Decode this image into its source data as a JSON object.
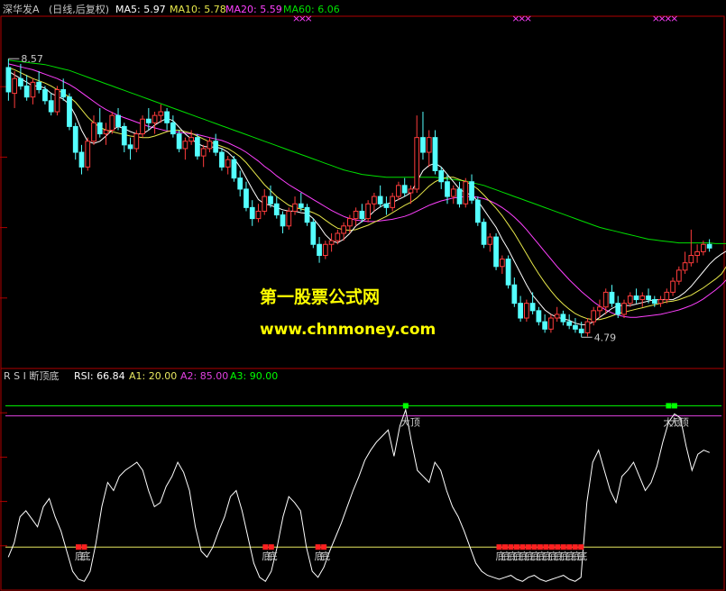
{
  "colors": {
    "up": "#ff3c3c",
    "down": "#54ffff",
    "ma5": "#ffffff",
    "ma10": "#e8e84a",
    "ma20": "#ff40ff",
    "ma60": "#00e000",
    "frame": "#b00000",
    "text": "#c8c8c8",
    "rsi": "#ffffff",
    "line_top": "#00ff00",
    "line_mid": "#e040e0",
    "line_bot": "#e8e860",
    "sig_top": "#00ff00",
    "sig_bot": "#ff2020",
    "watermark": "#ffff00"
  },
  "price_header": {
    "name": "深华发A",
    "period": "(日线,后复权)",
    "ma5": "MA5: 5.97",
    "ma10": "MA10: 5.78",
    "ma20": "MA20: 5.59",
    "ma60": "MA60: 6.06"
  },
  "rsi_header": {
    "title": "R S I 断顶底",
    "rsi": "RSI: 66.84",
    "a1": "A1: 20.00",
    "a2": "A2: 85.00",
    "a3": "A3: 90.00"
  },
  "watermark": {
    "line1": "第一股票公式网",
    "line2": "www.chnmoney.com"
  },
  "chart_data": [
    {
      "type": "candlestick",
      "ylim": [
        4.5,
        9.0
      ],
      "annotations": {
        "high_label": "8.57",
        "low_label": "4.79"
      },
      "ohlc": [
        [
          8.45,
          8.57,
          8.0,
          8.12
        ],
        [
          8.1,
          8.4,
          7.9,
          8.3
        ],
        [
          8.3,
          8.5,
          8.15,
          8.2
        ],
        [
          8.2,
          8.35,
          8.0,
          8.05
        ],
        [
          8.05,
          8.3,
          7.95,
          8.25
        ],
        [
          8.25,
          8.4,
          8.1,
          8.15
        ],
        [
          8.15,
          8.2,
          7.95,
          8.0
        ],
        [
          8.0,
          8.1,
          7.8,
          7.85
        ],
        [
          7.85,
          8.2,
          7.8,
          8.15
        ],
        [
          8.15,
          8.3,
          8.0,
          8.05
        ],
        [
          8.05,
          8.1,
          7.6,
          7.65
        ],
        [
          7.65,
          7.7,
          7.2,
          7.3
        ],
        [
          7.3,
          7.4,
          7.0,
          7.1
        ],
        [
          7.1,
          7.5,
          7.05,
          7.45
        ],
        [
          7.45,
          7.8,
          7.4,
          7.7
        ],
        [
          7.7,
          7.9,
          7.5,
          7.55
        ],
        [
          7.55,
          7.7,
          7.4,
          7.6
        ],
        [
          7.6,
          7.85,
          7.55,
          7.8
        ],
        [
          7.8,
          7.9,
          7.6,
          7.65
        ],
        [
          7.65,
          7.7,
          7.3,
          7.4
        ],
        [
          7.4,
          7.5,
          7.2,
          7.35
        ],
        [
          7.35,
          7.6,
          7.3,
          7.55
        ],
        [
          7.55,
          7.8,
          7.5,
          7.75
        ],
        [
          7.75,
          7.9,
          7.6,
          7.7
        ],
        [
          7.7,
          7.85,
          7.55,
          7.8
        ],
        [
          7.8,
          7.95,
          7.7,
          7.85
        ],
        [
          7.85,
          7.9,
          7.6,
          7.7
        ],
        [
          7.7,
          7.8,
          7.5,
          7.55
        ],
        [
          7.55,
          7.6,
          7.3,
          7.35
        ],
        [
          7.35,
          7.5,
          7.2,
          7.45
        ],
        [
          7.45,
          7.6,
          7.4,
          7.5
        ],
        [
          7.5,
          7.55,
          7.2,
          7.25
        ],
        [
          7.25,
          7.4,
          7.1,
          7.35
        ],
        [
          7.35,
          7.5,
          7.3,
          7.45
        ],
        [
          7.45,
          7.55,
          7.25,
          7.3
        ],
        [
          7.3,
          7.35,
          7.05,
          7.1
        ],
        [
          7.1,
          7.25,
          7.0,
          7.2
        ],
        [
          7.2,
          7.25,
          6.9,
          6.95
        ],
        [
          6.95,
          7.05,
          6.7,
          6.8
        ],
        [
          6.8,
          6.9,
          6.5,
          6.55
        ],
        [
          6.55,
          6.65,
          6.3,
          6.4
        ],
        [
          6.4,
          6.6,
          6.35,
          6.5
        ],
        [
          6.5,
          6.8,
          6.45,
          6.7
        ],
        [
          6.7,
          6.85,
          6.55,
          6.6
        ],
        [
          6.6,
          6.7,
          6.4,
          6.45
        ],
        [
          6.45,
          6.5,
          6.2,
          6.3
        ],
        [
          6.3,
          6.55,
          6.25,
          6.5
        ],
        [
          6.5,
          6.7,
          6.45,
          6.6
        ],
        [
          6.6,
          6.75,
          6.5,
          6.55
        ],
        [
          6.55,
          6.6,
          6.3,
          6.35
        ],
        [
          6.35,
          6.4,
          6.0,
          6.05
        ],
        [
          6.05,
          6.15,
          5.8,
          5.9
        ],
        [
          5.9,
          6.1,
          5.85,
          6.05
        ],
        [
          6.05,
          6.2,
          5.95,
          6.1
        ],
        [
          6.1,
          6.25,
          6.05,
          6.2
        ],
        [
          6.2,
          6.35,
          6.1,
          6.3
        ],
        [
          6.3,
          6.45,
          6.2,
          6.4
        ],
        [
          6.4,
          6.55,
          6.3,
          6.5
        ],
        [
          6.5,
          6.6,
          6.35,
          6.4
        ],
        [
          6.4,
          6.65,
          6.35,
          6.6
        ],
        [
          6.6,
          6.75,
          6.5,
          6.7
        ],
        [
          6.7,
          6.85,
          6.55,
          6.6
        ],
        [
          6.6,
          6.7,
          6.45,
          6.55
        ],
        [
          6.55,
          6.75,
          6.5,
          6.7
        ],
        [
          6.7,
          6.9,
          6.65,
          6.85
        ],
        [
          6.85,
          6.95,
          6.7,
          6.75
        ],
        [
          6.75,
          6.85,
          6.6,
          6.8
        ],
        [
          6.8,
          7.8,
          6.75,
          7.5
        ],
        [
          7.5,
          7.85,
          7.2,
          7.3
        ],
        [
          7.3,
          7.6,
          7.1,
          7.5
        ],
        [
          7.5,
          7.6,
          7.0,
          7.05
        ],
        [
          7.05,
          7.1,
          6.8,
          6.9
        ],
        [
          6.9,
          7.0,
          6.6,
          6.7
        ],
        [
          6.7,
          6.85,
          6.6,
          6.8
        ],
        [
          6.8,
          6.9,
          6.55,
          6.6
        ],
        [
          6.6,
          6.95,
          6.55,
          6.9
        ],
        [
          6.9,
          7.0,
          6.6,
          6.65
        ],
        [
          6.65,
          6.7,
          6.3,
          6.35
        ],
        [
          6.35,
          6.4,
          6.0,
          6.05
        ],
        [
          6.05,
          6.2,
          5.95,
          6.15
        ],
        [
          6.15,
          6.2,
          5.7,
          5.75
        ],
        [
          5.75,
          5.9,
          5.65,
          5.85
        ],
        [
          5.85,
          5.9,
          5.45,
          5.5
        ],
        [
          5.5,
          5.6,
          5.2,
          5.25
        ],
        [
          5.25,
          5.35,
          5.0,
          5.05
        ],
        [
          5.05,
          5.3,
          5.0,
          5.25
        ],
        [
          5.25,
          5.4,
          5.1,
          5.15
        ],
        [
          5.15,
          5.2,
          4.95,
          5.0
        ],
        [
          5.0,
          5.1,
          4.85,
          4.9
        ],
        [
          4.9,
          5.1,
          4.85,
          5.05
        ],
        [
          5.05,
          5.2,
          5.0,
          5.1
        ],
        [
          5.1,
          5.15,
          4.95,
          5.0
        ],
        [
          5.0,
          5.1,
          4.9,
          4.95
        ],
        [
          4.95,
          5.05,
          4.85,
          4.9
        ],
        [
          4.9,
          5.0,
          4.79,
          4.85
        ],
        [
          4.85,
          5.05,
          4.8,
          5.0
        ],
        [
          5.0,
          5.2,
          4.95,
          5.15
        ],
        [
          5.15,
          5.3,
          5.05,
          5.2
        ],
        [
          5.2,
          5.45,
          5.1,
          5.4
        ],
        [
          5.4,
          5.5,
          5.2,
          5.25
        ],
        [
          5.25,
          5.35,
          5.05,
          5.1
        ],
        [
          5.1,
          5.3,
          5.05,
          5.25
        ],
        [
          5.25,
          5.4,
          5.2,
          5.35
        ],
        [
          5.35,
          5.45,
          5.25,
          5.3
        ],
        [
          5.3,
          5.4,
          5.2,
          5.35
        ],
        [
          5.35,
          5.45,
          5.25,
          5.3
        ],
        [
          5.3,
          5.35,
          5.2,
          5.25
        ],
        [
          5.25,
          5.35,
          5.2,
          5.3
        ],
        [
          5.3,
          5.45,
          5.25,
          5.4
        ],
        [
          5.4,
          5.6,
          5.35,
          5.55
        ],
        [
          5.55,
          5.75,
          5.5,
          5.7
        ],
        [
          5.7,
          5.95,
          5.65,
          5.8
        ],
        [
          5.8,
          6.25,
          5.75,
          5.9
        ],
        [
          5.9,
          6.05,
          5.8,
          5.95
        ],
        [
          5.95,
          6.1,
          5.9,
          6.05
        ],
        [
          6.05,
          6.12,
          5.95,
          6.0
        ]
      ],
      "ma5": [
        8.4,
        8.35,
        8.3,
        8.25,
        8.2,
        8.2,
        8.17,
        8.1,
        8.06,
        8.02,
        7.95,
        7.8,
        7.6,
        7.45,
        7.42,
        7.45,
        7.52,
        7.6,
        7.65,
        7.62,
        7.58,
        7.55,
        7.55,
        7.6,
        7.67,
        7.72,
        7.76,
        7.73,
        7.64,
        7.55,
        7.48,
        7.42,
        7.38,
        7.37,
        7.37,
        7.35,
        7.3,
        7.22,
        7.1,
        6.95,
        6.8,
        6.66,
        6.6,
        6.58,
        6.55,
        6.52,
        6.5,
        6.5,
        6.48,
        6.47,
        6.4,
        6.3,
        6.18,
        6.1,
        6.07,
        6.12,
        6.2,
        6.3,
        6.36,
        6.42,
        6.5,
        6.56,
        6.6,
        6.62,
        6.66,
        6.7,
        6.75,
        6.9,
        7.05,
        7.12,
        7.15,
        7.1,
        7.0,
        6.9,
        6.8,
        6.75,
        6.72,
        6.64,
        6.52,
        6.4,
        6.28,
        6.12,
        5.98,
        5.82,
        5.66,
        5.5,
        5.36,
        5.26,
        5.16,
        5.1,
        5.06,
        5.04,
        5.02,
        4.98,
        4.96,
        4.96,
        5.0,
        5.06,
        5.12,
        5.18,
        5.22,
        5.22,
        5.22,
        5.24,
        5.26,
        5.28,
        5.3,
        5.3,
        5.3,
        5.3,
        5.34,
        5.4,
        5.48,
        5.58,
        5.68,
        5.78,
        5.86,
        5.92,
        5.97
      ],
      "ma10": [
        8.45,
        8.42,
        8.38,
        8.34,
        8.3,
        8.27,
        8.24,
        8.2,
        8.15,
        8.1,
        8.05,
        7.98,
        7.88,
        7.78,
        7.7,
        7.64,
        7.6,
        7.58,
        7.56,
        7.54,
        7.52,
        7.51,
        7.5,
        7.5,
        7.52,
        7.55,
        7.58,
        7.6,
        7.6,
        7.58,
        7.56,
        7.52,
        7.48,
        7.44,
        7.41,
        7.38,
        7.35,
        7.3,
        7.24,
        7.16,
        7.06,
        6.96,
        6.86,
        6.78,
        6.7,
        6.64,
        6.58,
        6.55,
        6.53,
        6.51,
        6.48,
        6.44,
        6.38,
        6.32,
        6.27,
        6.25,
        6.24,
        6.25,
        6.28,
        6.31,
        6.35,
        6.39,
        6.43,
        6.48,
        6.53,
        6.58,
        6.62,
        6.68,
        6.76,
        6.84,
        6.9,
        6.94,
        6.96,
        6.96,
        6.93,
        6.9,
        6.86,
        6.8,
        6.72,
        6.63,
        6.54,
        6.44,
        6.32,
        6.2,
        6.06,
        5.92,
        5.78,
        5.65,
        5.53,
        5.42,
        5.32,
        5.24,
        5.17,
        5.11,
        5.07,
        5.04,
        5.03,
        5.03,
        5.05,
        5.08,
        5.11,
        5.13,
        5.15,
        5.17,
        5.19,
        5.21,
        5.23,
        5.25,
        5.27,
        5.28,
        5.3,
        5.33,
        5.36,
        5.41,
        5.46,
        5.52,
        5.58,
        5.65,
        5.78
      ],
      "ma20": [
        8.5,
        8.48,
        8.46,
        8.44,
        8.42,
        8.39,
        8.36,
        8.33,
        8.3,
        8.26,
        8.22,
        8.17,
        8.11,
        8.05,
        7.99,
        7.93,
        7.88,
        7.84,
        7.8,
        7.77,
        7.74,
        7.71,
        7.68,
        7.65,
        7.63,
        7.61,
        7.59,
        7.58,
        7.57,
        7.56,
        7.55,
        7.54,
        7.52,
        7.5,
        7.48,
        7.46,
        7.43,
        7.39,
        7.35,
        7.3,
        7.24,
        7.18,
        7.11,
        7.05,
        6.98,
        6.92,
        6.86,
        6.81,
        6.76,
        6.71,
        6.66,
        6.61,
        6.56,
        6.51,
        6.47,
        6.43,
        6.4,
        6.38,
        6.37,
        6.36,
        6.36,
        6.37,
        6.38,
        6.39,
        6.41,
        6.43,
        6.46,
        6.5,
        6.54,
        6.58,
        6.61,
        6.64,
        6.66,
        6.68,
        6.69,
        6.7,
        6.7,
        6.69,
        6.67,
        6.64,
        6.6,
        6.55,
        6.49,
        6.42,
        6.34,
        6.25,
        6.15,
        6.05,
        5.95,
        5.85,
        5.75,
        5.66,
        5.57,
        5.49,
        5.41,
        5.34,
        5.27,
        5.21,
        5.16,
        5.12,
        5.09,
        5.07,
        5.06,
        5.06,
        5.07,
        5.08,
        5.09,
        5.1,
        5.12,
        5.14,
        5.16,
        5.19,
        5.22,
        5.26,
        5.31,
        5.37,
        5.43,
        5.5,
        5.59
      ],
      "ma60": [
        8.55,
        8.54,
        8.53,
        8.52,
        8.51,
        8.5,
        8.49,
        8.47,
        8.45,
        8.43,
        8.41,
        8.38,
        8.35,
        8.32,
        8.29,
        8.26,
        8.23,
        8.2,
        8.17,
        8.14,
        8.11,
        8.08,
        8.05,
        8.02,
        7.99,
        7.96,
        7.93,
        7.9,
        7.87,
        7.84,
        7.81,
        7.78,
        7.75,
        7.72,
        7.69,
        7.66,
        7.63,
        7.6,
        7.57,
        7.54,
        7.51,
        7.48,
        7.45,
        7.42,
        7.39,
        7.36,
        7.33,
        7.3,
        7.27,
        7.24,
        7.21,
        7.18,
        7.15,
        7.12,
        7.09,
        7.06,
        7.04,
        7.02,
        7.0,
        6.99,
        6.98,
        6.97,
        6.96,
        6.96,
        6.96,
        6.96,
        6.96,
        6.96,
        6.96,
        6.96,
        6.96,
        6.95,
        6.94,
        6.93,
        6.92,
        6.91,
        6.89,
        6.87,
        6.85,
        6.82,
        6.79,
        6.76,
        6.73,
        6.7,
        6.67,
        6.64,
        6.61,
        6.58,
        6.55,
        6.52,
        6.49,
        6.46,
        6.43,
        6.4,
        6.37,
        6.34,
        6.31,
        6.28,
        6.26,
        6.24,
        6.22,
        6.2,
        6.18,
        6.16,
        6.14,
        6.12,
        6.11,
        6.1,
        6.09,
        6.08,
        6.07,
        6.07,
        6.07,
        6.07,
        6.07,
        6.07,
        6.06,
        6.06,
        6.06
      ]
    },
    {
      "type": "line",
      "ylim": [
        0,
        100
      ],
      "thresholds": {
        "A1": 20,
        "A2": 85,
        "A3": 90
      },
      "signal_labels": {
        "top": "大顶",
        "bottom": "底"
      },
      "rsi": [
        15,
        22,
        35,
        38,
        34,
        30,
        40,
        44,
        35,
        28,
        18,
        8,
        4,
        3,
        8,
        22,
        40,
        52,
        48,
        55,
        58,
        60,
        62,
        58,
        48,
        40,
        42,
        50,
        55,
        62,
        57,
        48,
        30,
        18,
        15,
        20,
        28,
        35,
        45,
        48,
        38,
        25,
        12,
        5,
        3,
        8,
        20,
        35,
        45,
        42,
        38,
        20,
        8,
        5,
        10,
        18,
        25,
        32,
        40,
        48,
        55,
        63,
        68,
        72,
        75,
        78,
        65,
        80,
        88,
        72,
        58,
        55,
        52,
        62,
        58,
        48,
        40,
        35,
        28,
        20,
        12,
        8,
        6,
        5,
        4,
        5,
        6,
        4,
        3,
        5,
        6,
        4,
        3,
        4,
        5,
        6,
        4,
        3,
        5,
        42,
        62,
        68,
        58,
        48,
        42,
        55,
        58,
        62,
        55,
        48,
        52,
        60,
        72,
        82,
        86,
        84,
        70,
        58,
        66,
        68,
        66.84
      ],
      "bottom_signal_idx": [
        12,
        13,
        44,
        45,
        53,
        54,
        84,
        85,
        86,
        87,
        88,
        89,
        90,
        91,
        92,
        93,
        94,
        95,
        96,
        97,
        98
      ],
      "top_signal_idx": [
        68,
        113,
        114
      ]
    }
  ]
}
